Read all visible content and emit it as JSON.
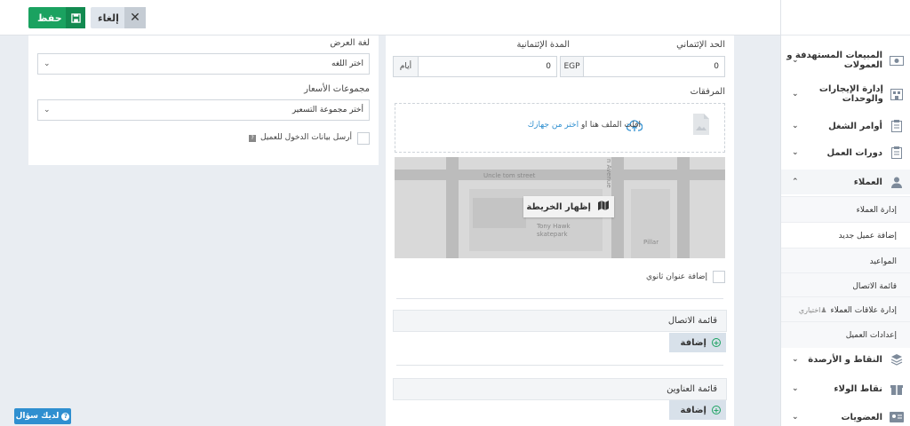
{
  "toolbar": {
    "save_label": "حفظ",
    "cancel_label": "إلغاء"
  },
  "left": {
    "display_language_label": "لغة العرض",
    "display_language_value": "اختر اللغه",
    "price_groups_label": "مجموعات الأسعار",
    "price_groups_value": "أختر مجموعة التسعير",
    "send_login_label": "أرسل بيانات الدخول للعميل"
  },
  "main": {
    "credit_limit_label": "الحد الإئتماني",
    "credit_limit_value": "0",
    "currency": "EGP",
    "credit_period_label": "المدة الإئتمانية",
    "credit_period_value": "0",
    "period_unit": "أيام",
    "attachments_label": "المرفقات",
    "drop_text": "افلت الملف هنا او",
    "choose_link": "اختر من جهازك",
    "map": {
      "show_map_label": "إظهار الخريطة",
      "street1": "Uncle tom street",
      "street2": "n Avenue",
      "place1": "Tony Hawk",
      "place1b": "skatepark",
      "place2": "Pillar"
    },
    "secondary_address_label": "إضافة عنوان ثانوي",
    "contact_list_title": "قائمة الاتصال",
    "address_list_title": "قائمة العناوين",
    "add_label": "إضافة"
  },
  "sidebar": {
    "items": [
      {
        "label": "المبيعات المستهدفة و العمولات",
        "icon": "money-icon"
      },
      {
        "label": "إدارة الإيجارات والوحدات",
        "icon": "building-icon"
      },
      {
        "label": "أوامر الشغل",
        "icon": "clipboard-icon"
      },
      {
        "label": "دورات العمل",
        "icon": "clipboard-icon"
      },
      {
        "label": "العملاء",
        "icon": "user-icon"
      },
      {
        "label": "النقاط و الأرصدة",
        "icon": "layers-icon"
      },
      {
        "label": "نقاط الولاء",
        "icon": "gift-icon"
      },
      {
        "label": "العضويات",
        "icon": "card-icon"
      }
    ],
    "sub_items": [
      "إدارة العملاء",
      "إضافة عميل جديد",
      "المواعيد",
      "قائمة الاتصال",
      "إدارة علاقات العملاء",
      "إعدادات العميل"
    ],
    "optional_tag": "اختياري"
  },
  "help_label": "لديك سؤال"
}
